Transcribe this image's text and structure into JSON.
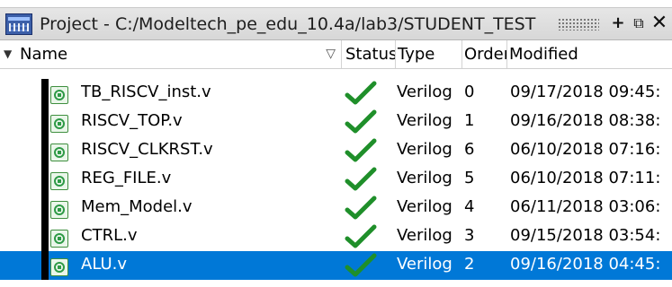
{
  "window": {
    "title": "Project - C:/Modeltech_pe_edu_10.4a/lab3/STUDENT_TEST",
    "icon": "project-window-icon",
    "buttons": {
      "add": "+",
      "undock": "⧉",
      "close": "✕"
    }
  },
  "columns": {
    "name": "Name",
    "status": "Status",
    "type": "Type",
    "order": "Order",
    "modified": "Modified"
  },
  "files": [
    {
      "name": "TB_RISCV_inst.v",
      "status_icon": "green-check-icon",
      "type": "Verilog",
      "order": "0",
      "modified": "09/17/2018 09:45:",
      "selected": false
    },
    {
      "name": "RISCV_TOP.v",
      "status_icon": "green-check-icon",
      "type": "Verilog",
      "order": "1",
      "modified": "09/16/2018 08:38:",
      "selected": false
    },
    {
      "name": "RISCV_CLKRST.v",
      "status_icon": "green-check-icon",
      "type": "Verilog",
      "order": "6",
      "modified": "06/10/2018 07:16:",
      "selected": false
    },
    {
      "name": "REG_FILE.v",
      "status_icon": "green-check-icon",
      "type": "Verilog",
      "order": "5",
      "modified": "06/10/2018 07:11:",
      "selected": false
    },
    {
      "name": "Mem_Model.v",
      "status_icon": "green-check-icon",
      "type": "Verilog",
      "order": "4",
      "modified": "06/11/2018 03:06:",
      "selected": false
    },
    {
      "name": "CTRL.v",
      "status_icon": "green-check-icon",
      "type": "Verilog",
      "order": "3",
      "modified": "09/15/2018 03:54:",
      "selected": false
    },
    {
      "name": "ALU.v",
      "status_icon": "green-check-icon",
      "type": "Verilog",
      "order": "2",
      "modified": "09/16/2018 04:45:",
      "selected": true
    }
  ],
  "colors": {
    "selection": "#0078d7",
    "check": "#1f8f2a"
  }
}
